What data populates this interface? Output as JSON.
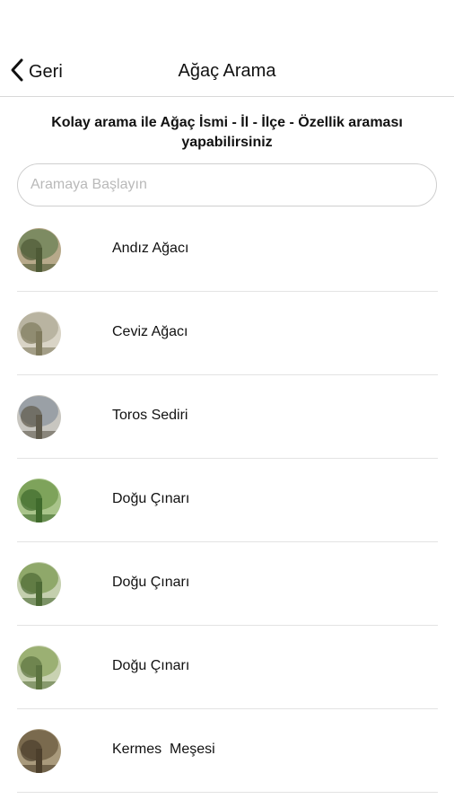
{
  "nav": {
    "back_label": "Geri",
    "title": "Ağaç Arama"
  },
  "intro_text": "Kolay arama ile Ağaç İsmi - İl - İlçe - Özellik araması yapabilirsiniz",
  "search": {
    "placeholder": "Aramaya Başlayın",
    "value": ""
  },
  "trees": [
    {
      "name": "Andız Ağacı",
      "thumb_colors": [
        "#7d8b62",
        "#4e5a36",
        "#b7a98a"
      ]
    },
    {
      "name": "Ceviz Ağacı",
      "thumb_colors": [
        "#b9b4a1",
        "#7f7a5d",
        "#d9d4c6"
      ]
    },
    {
      "name": "Toros Sediri",
      "thumb_colors": [
        "#9aa0a6",
        "#5f5a4c",
        "#c8c6c0"
      ]
    },
    {
      "name": "Doğu Çınarı",
      "thumb_colors": [
        "#7ea35b",
        "#3f6a2c",
        "#a9c48a"
      ]
    },
    {
      "name": "Doğu Çınarı",
      "thumb_colors": [
        "#8fa86a",
        "#4d6a35",
        "#c4cfae"
      ]
    },
    {
      "name": "Doğu Çınarı",
      "thumb_colors": [
        "#9bb073",
        "#5c7340",
        "#c9d2b2"
      ]
    },
    {
      "name": "Kermes  Meşesi",
      "thumb_colors": [
        "#7a6a4e",
        "#4c3f2c",
        "#a99a7c"
      ]
    }
  ]
}
